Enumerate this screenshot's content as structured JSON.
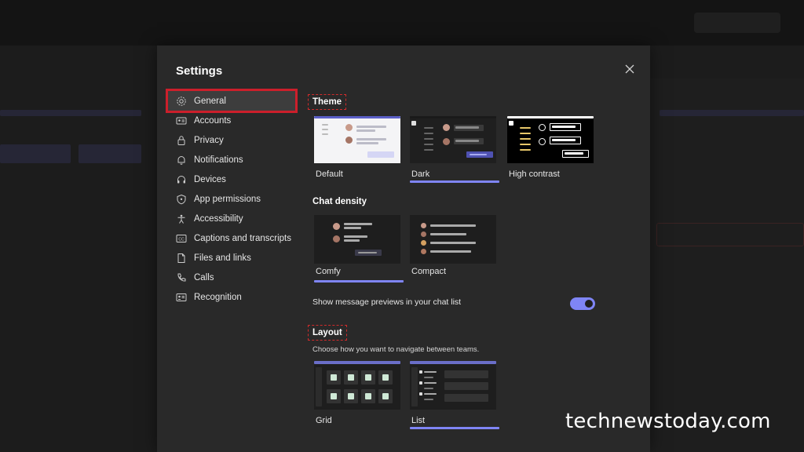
{
  "dialog": {
    "title": "Settings"
  },
  "nav": {
    "items": [
      {
        "label": "General",
        "icon": "gear-icon",
        "active": true
      },
      {
        "label": "Accounts",
        "icon": "id-card-icon"
      },
      {
        "label": "Privacy",
        "icon": "lock-icon"
      },
      {
        "label": "Notifications",
        "icon": "bell-icon"
      },
      {
        "label": "Devices",
        "icon": "headset-icon"
      },
      {
        "label": "App permissions",
        "icon": "shield-icon"
      },
      {
        "label": "Accessibility",
        "icon": "accessibility-icon"
      },
      {
        "label": "Captions and transcripts",
        "icon": "cc-icon"
      },
      {
        "label": "Files and links",
        "icon": "file-icon"
      },
      {
        "label": "Calls",
        "icon": "phone-icon"
      },
      {
        "label": "Recognition",
        "icon": "recognition-icon"
      }
    ]
  },
  "theme": {
    "title": "Theme",
    "options": [
      {
        "label": "Default",
        "selected": false
      },
      {
        "label": "Dark",
        "selected": true
      },
      {
        "label": "High contrast",
        "selected": false
      }
    ]
  },
  "density": {
    "title": "Chat density",
    "options": [
      {
        "label": "Comfy",
        "selected": true
      },
      {
        "label": "Compact",
        "selected": false
      }
    ]
  },
  "previews": {
    "label": "Show message previews in your chat list",
    "enabled": true
  },
  "layout": {
    "title": "Layout",
    "description": "Choose how you want to navigate between teams.",
    "options": [
      {
        "label": "Grid",
        "selected": false
      },
      {
        "label": "List",
        "selected": true
      }
    ]
  },
  "watermark": "technewstoday.com",
  "colors": {
    "accent": "#7f85f5",
    "highlight": "#cc1f2b",
    "dialog_bg": "#292929"
  }
}
